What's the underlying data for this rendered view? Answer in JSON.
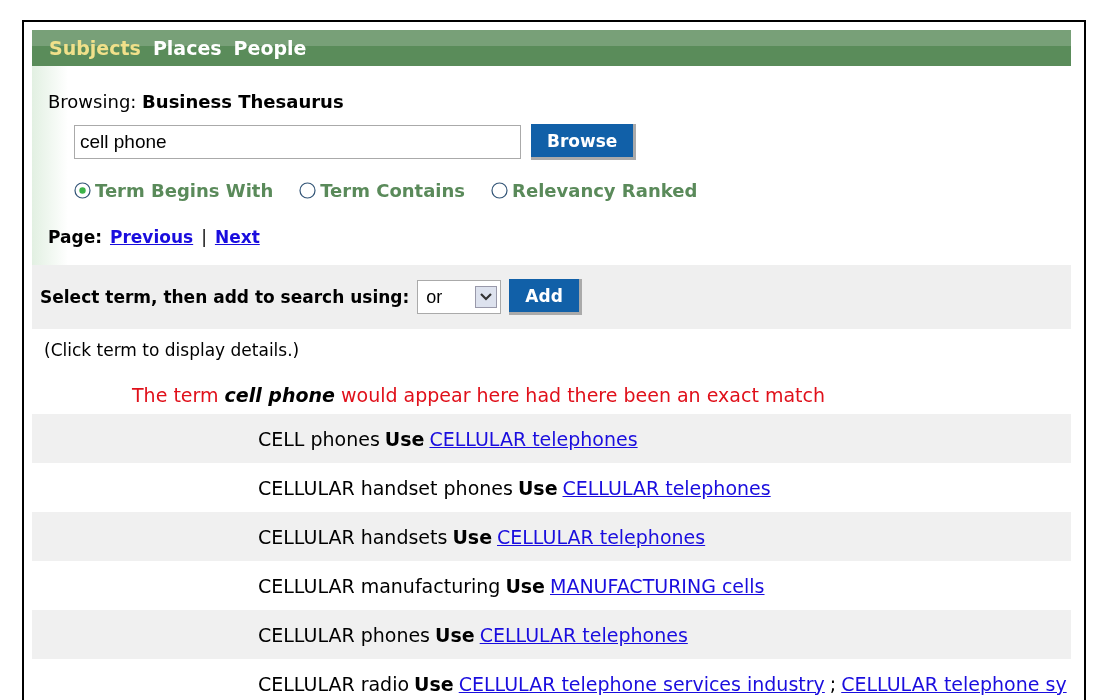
{
  "tabs": [
    {
      "label": "Subjects",
      "selected": true
    },
    {
      "label": "Places",
      "selected": false
    },
    {
      "label": "People",
      "selected": false
    }
  ],
  "browsing": {
    "label": "Browsing:",
    "value": "Business Thesaurus"
  },
  "search": {
    "value": "cell phone",
    "button": "Browse"
  },
  "search_modes": [
    {
      "label": "Term Begins With",
      "selected": true
    },
    {
      "label": "Term Contains",
      "selected": false
    },
    {
      "label": "Relevancy Ranked",
      "selected": false
    }
  ],
  "pager": {
    "label": "Page:",
    "links": [
      "Previous",
      "Next"
    ],
    "separator": "|"
  },
  "add_bar": {
    "label": "Select term, then add to search using:",
    "operator": "or",
    "button": "Add"
  },
  "hint": "(Click term to display details.)",
  "no_match": "The term **cell phone** would appear here had there been an exact match",
  "rows": [
    {
      "term": "CELL phones",
      "use": "Use",
      "links": [
        "CELLULAR telephones"
      ]
    },
    {
      "term": "CELLULAR handset phones",
      "use": "Use",
      "links": [
        "CELLULAR telephones"
      ]
    },
    {
      "term": "CELLULAR handsets",
      "use": "Use",
      "links": [
        "CELLULAR telephones"
      ]
    },
    {
      "term": "CELLULAR manufacturing",
      "use": "Use",
      "links": [
        "MANUFACTURING cells"
      ]
    },
    {
      "term": "CELLULAR phones",
      "use": "Use",
      "links": [
        "CELLULAR telephones"
      ]
    },
    {
      "term": "CELLULAR radio",
      "use": "Use",
      "links": [
        "CELLULAR telephone services industry",
        "CELLULAR telephone sy"
      ],
      "separator": ";"
    }
  ]
}
